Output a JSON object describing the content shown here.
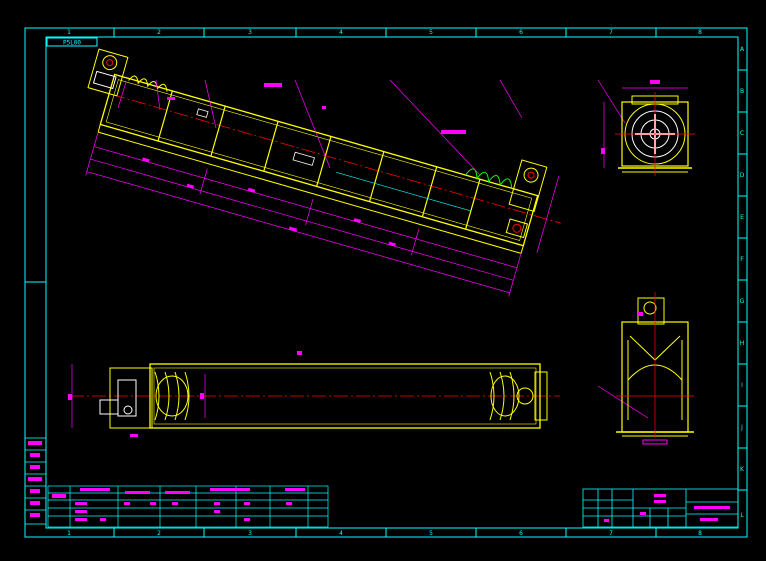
{
  "drawing": {
    "top_left_box": "P5L00",
    "col_numbers": [
      "1",
      "2",
      "3",
      "4",
      "5",
      "6",
      "7",
      "8"
    ],
    "row_letters": [
      "A",
      "B",
      "C",
      "D",
      "E",
      "F",
      "G",
      "H",
      "I",
      "J",
      "K",
      "L"
    ]
  },
  "colors": {
    "frame": "#00ffff",
    "outline": "#ffff00",
    "dimension": "#ff00ff",
    "centerline": "#ff0000",
    "part": "#ffffff",
    "hatch": "#00ff00"
  }
}
